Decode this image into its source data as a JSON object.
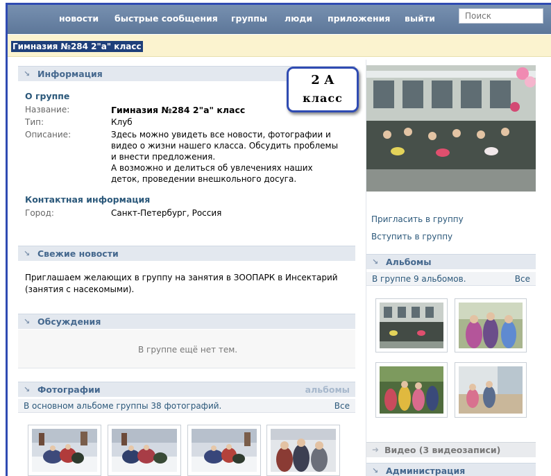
{
  "nav": {
    "news": "новости",
    "messages": "быстрые сообщения",
    "groups": "группы",
    "people": "люди",
    "apps": "приложения",
    "logout": "выйти",
    "search_placeholder": "Поиск"
  },
  "group_title": "Гимназия №284 2\"а\" класс",
  "badge": {
    "line1": "2 А",
    "line2": "класс"
  },
  "info": {
    "header": "Информация",
    "about_title": "О группе",
    "name_label": "Название:",
    "name_value": "Гимназия №284 2\"а\" класс",
    "type_label": "Тип:",
    "type_value": "Клуб",
    "desc_label": "Описание:",
    "desc_lines": [
      "Здесь можно увидеть все новости, фотографии и",
      "видео о жизни нашего класса. Обсудить проблемы",
      "и внести предложения.",
      "А возможно и делиться об увлечениях наших",
      "деток, проведении внешкольного досуга."
    ],
    "contacts_title": "Контактная информация",
    "city_label": "Город:",
    "city_value": "Санкт-Петербург, Россия"
  },
  "news": {
    "header": "Свежие новости",
    "lines": [
      "Приглашаем желающих в группу на занятия в ЗООПАРК в Инсектарий",
      "(занятия с насекомыми)."
    ]
  },
  "discussions": {
    "header": "Обсуждения",
    "empty": "В группе ещё нет тем."
  },
  "photos": {
    "header": "Фотографии",
    "albums_link": "альбомы",
    "count_text": "В основном альбоме группы 38 фотографий.",
    "all_link": "Все"
  },
  "sidebar": {
    "invite": "Пригласить в группу",
    "join": "Вступить в группу",
    "albums_header": "Альбомы",
    "albums_count": "В группе 9 альбомов.",
    "albums_all": "Все",
    "video": "Видео (3 видеозаписи)",
    "admin": "Администрация"
  },
  "colors": {
    "nav_bg": "#6983a6",
    "link": "#2b587a",
    "header_text": "#45688e",
    "title_bar": "#fbf3cf",
    "frame_border": "#2f4bb2"
  }
}
